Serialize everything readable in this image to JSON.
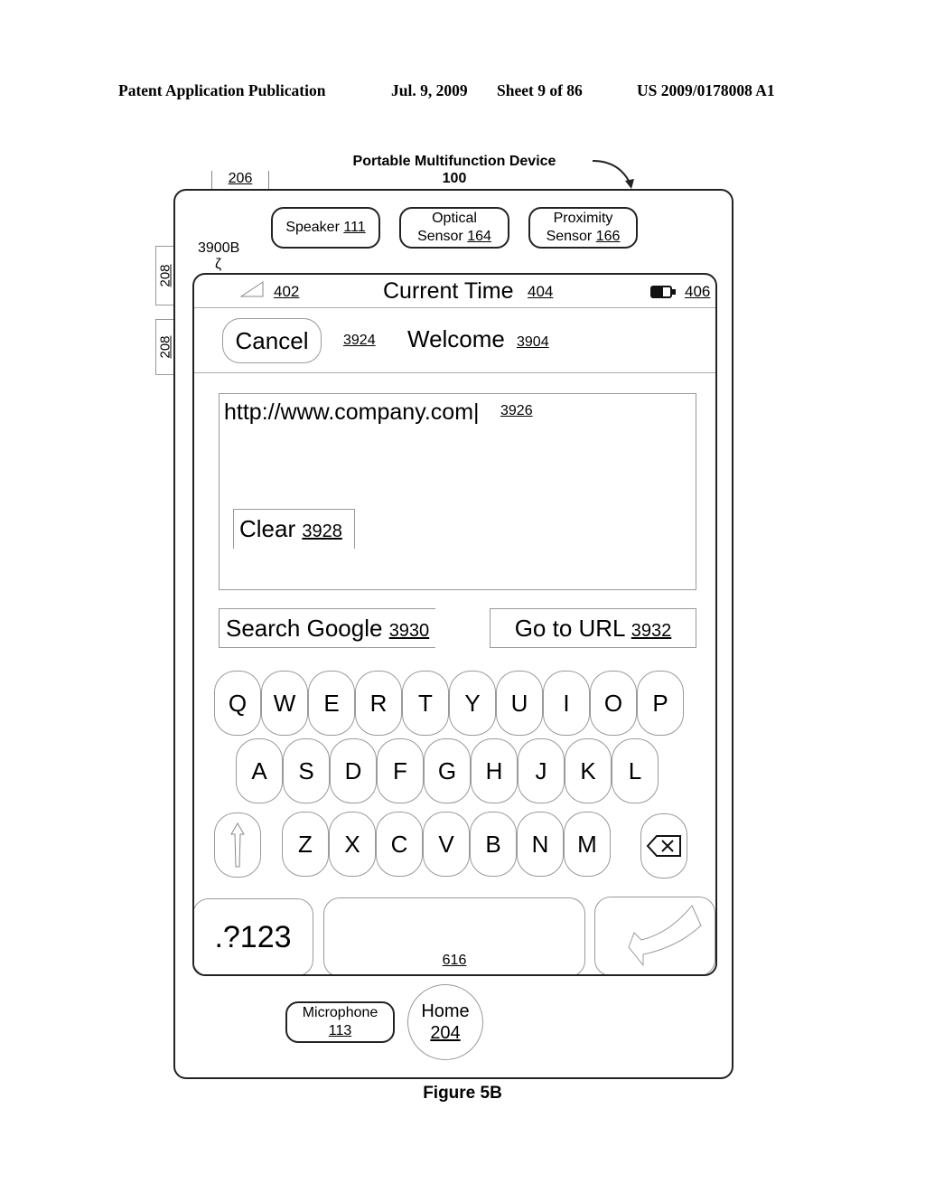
{
  "header": {
    "publication": "Patent Application Publication",
    "date": "Jul. 9, 2009",
    "sheet": "Sheet 9 of 86",
    "number": "US 2009/0178008 A1"
  },
  "device": {
    "title": "Portable Multifunction Device",
    "ref": "100",
    "ref_206": "206",
    "side_buttons": [
      "208",
      "208"
    ],
    "screen_ref": "3900B",
    "squiggle": "ζ",
    "speaker": {
      "label": "Speaker",
      "ref": "111"
    },
    "optical_sensor": {
      "label1": "Optical",
      "label2": "Sensor",
      "ref": "164"
    },
    "proximity_sensor": {
      "label1": "Proximity",
      "label2": "Sensor",
      "ref": "166"
    },
    "microphone": {
      "label": "Microphone",
      "ref": "113"
    },
    "home": {
      "label": "Home",
      "ref": "204"
    }
  },
  "status_bar": {
    "signal_icon": "signal-icon",
    "signal_ref": "402",
    "time_label": "Current Time",
    "time_ref": "404",
    "battery_icon": "battery-icon",
    "battery_ref": "406"
  },
  "navbar": {
    "cancel_label": "Cancel",
    "cancel_ref": "3924",
    "title": "Welcome",
    "title_ref": "3904"
  },
  "url_field": {
    "value": "http://www.company.com|",
    "ref": "3926",
    "clear_label": "Clear",
    "clear_ref": "3928"
  },
  "actions": {
    "search_label": "Search Google",
    "search_ref": "3930",
    "go_label": "Go to URL",
    "go_ref": "3932"
  },
  "keyboard": {
    "row1": [
      "Q",
      "W",
      "E",
      "R",
      "T",
      "Y",
      "U",
      "I",
      "O",
      "P"
    ],
    "row2": [
      "A",
      "S",
      "D",
      "F",
      "G",
      "H",
      "J",
      "K",
      "L"
    ],
    "row3": [
      "Z",
      "X",
      "C",
      "V",
      "B",
      "N",
      "M"
    ],
    "shift_icon": "shift-arrow-icon",
    "backspace_icon": "backspace-icon",
    "numbers_label": ".?123",
    "space_ref": "616",
    "return_icon": "return-arrow-icon"
  },
  "figure_caption": "Figure 5B"
}
